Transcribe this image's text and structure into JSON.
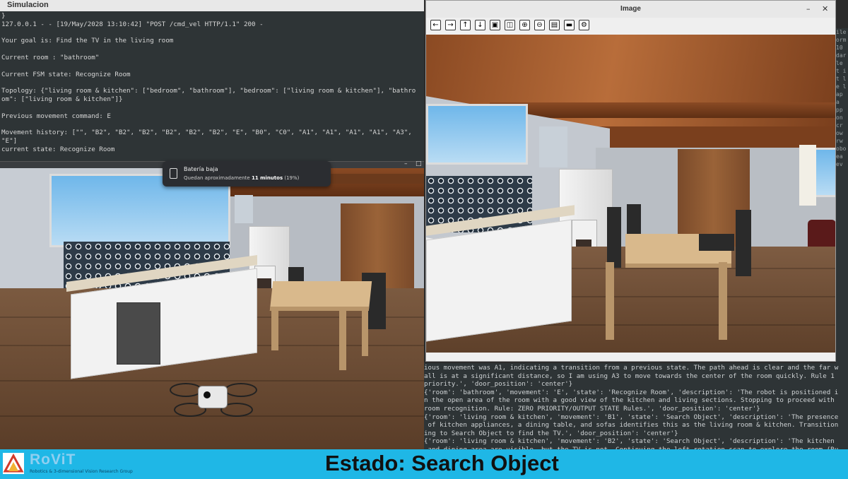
{
  "sim_window": {
    "title": "Simulacion",
    "terminal_lines": [
      "}",
      "127.0.0.1 - - [19/May/2028 13:10:42] \"POST /cmd_vel HTTP/1.1\" 200 -",
      "",
      "Your goal is: Find the TV in the living room",
      "",
      "Current room : \"bathroom\"",
      "",
      "Current FSM state: Recognize Room",
      "",
      "Topology: {\"living room & kitchen\": [\"bedroom\", \"bathroom\"], \"bedroom\": [\"living room & kitchen\"], \"bathro",
      "om\": [\"living room & kitchen\"]}",
      "",
      "Previous movement command: E",
      "",
      "Movement history: [\"\", \"B2\", \"B2\", \"B2\", \"B2\", \"B2\", \"B2\", \"E\", \"B0\", \"C0\", \"A1\", \"A1\", \"A1\", \"A1\", \"A3\",",
      "\"E\"]",
      "current state: Recognize Room"
    ]
  },
  "notification": {
    "title": "Batería baja",
    "body_prefix": "Quedan aproximadamente ",
    "body_bold": "11 minutos",
    "body_suffix": " (19%)"
  },
  "image_window": {
    "title": "Image",
    "toolbar": [
      "back-arrow-icon",
      "forward-arrow-icon",
      "up-arrow-icon",
      "down-arrow-icon",
      "save-icon",
      "image-icon",
      "zoom-in-icon",
      "zoom-out-icon",
      "save-as-icon",
      "window-icon",
      "settings-icon"
    ]
  },
  "log_lines": [
    "ious movement was A1, indicating a transition from a previous state. The path ahead is clear and the far w",
    "all is at a significant distance, so I am using A3 to move towards the center of the room quickly. Rule 1",
    "priority.', 'door_position': 'center'}",
    "{'room': 'bathroom', 'movement': 'E', 'state': 'Recognize Room', 'description': 'The robot is positioned i",
    "n the open area of the room with a good view of the kitchen and living sections. Stopping to proceed with",
    "room recognition. Rule: ZERO PRIORITY/OUTPUT STATE Rules.', 'door_position': 'center'}",
    "{'room': 'living room & kitchen', 'movement': 'B1', 'state': 'Search Object', 'description': 'The presence",
    " of kitchen appliances, a dining table, and sofas identifies this as the living room & kitchen. Transition",
    "ing to Search Object to find the TV.', 'door_position': 'center'}",
    "{'room': 'living room & kitchen', 'movement': 'B2', 'state': 'Search Object', 'description': 'The kitchen",
    " and dining area are visible, but the TV is not. Continuing the left rotation scan to explore the room (Ru"
  ],
  "edge_terminal": [
    "",
    "ile",
    "",
    "orm",
    "",
    "10",
    "",
    "dar",
    "le",
    "",
    "",
    "",
    "t i",
    "",
    "",
    "t l",
    "",
    "e l",
    "ap",
    "",
    "",
    "a",
    "pp",
    "on",
    "cr",
    "",
    "",
    "ow",
    "rw",
    "",
    "",
    "",
    "",
    "",
    "",
    "",
    "",
    "obo",
    "ea",
    "ev"
  ],
  "banner": {
    "logo_name": "RoViT",
    "logo_subtitle": "Robotics & 3-dimensional Vision Research Group",
    "state_label": "Estado: Search Object"
  },
  "colors": {
    "banner": "#1fb7e6",
    "terminal_bg": "#2e3436",
    "terminal_text": "#d6d6d6"
  }
}
